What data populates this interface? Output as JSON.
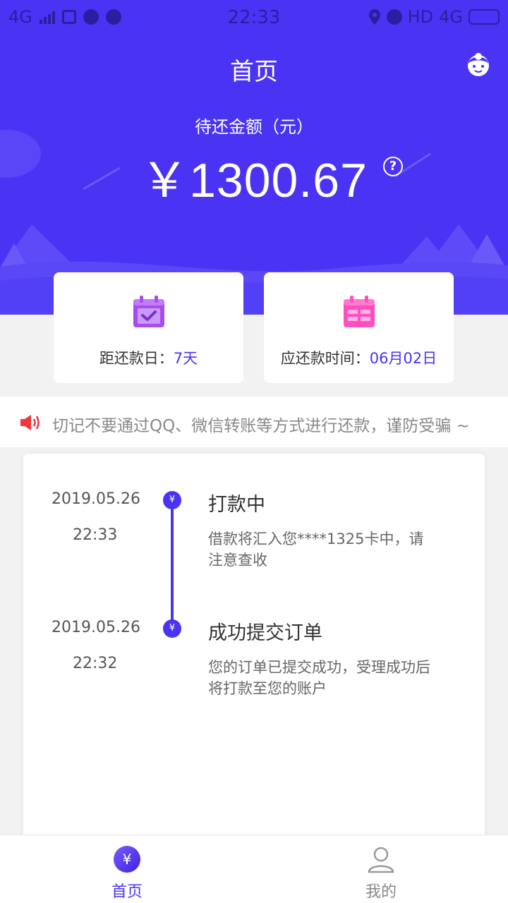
{
  "status_bar": {
    "network_left": "4G",
    "time": "22:33",
    "hd": "HD",
    "network_right": "4G"
  },
  "header": {
    "title": "首页",
    "amount_label": "待还金额（元）",
    "amount": "￥1300.67"
  },
  "cards": {
    "days_label": "距还款日：",
    "days_value": "7天",
    "due_label": "应还款时间：",
    "due_value": "06月02日"
  },
  "notice": {
    "text": "切记不要通过QQ、微信转账等方式进行还款，谨防受骗 ~"
  },
  "timeline": [
    {
      "date": "2019.05.26",
      "time": "22:33",
      "title": "打款中",
      "desc": "借款将汇入您****1325卡中，请注意查收",
      "marker": "¥"
    },
    {
      "date": "2019.05.26",
      "time": "22:32",
      "title": "成功提交订单",
      "desc": "您的订单已提交成功，受理成功后将打款至您的账户",
      "marker": "¥"
    }
  ],
  "nav": {
    "home": "首页",
    "me": "我的",
    "home_icon_glyph": "¥"
  },
  "colors": {
    "primary": "#4b33f4",
    "accent_pink": "#ff4fbf",
    "accent_purple": "#a84cf0",
    "notice_red": "#f0353b"
  }
}
